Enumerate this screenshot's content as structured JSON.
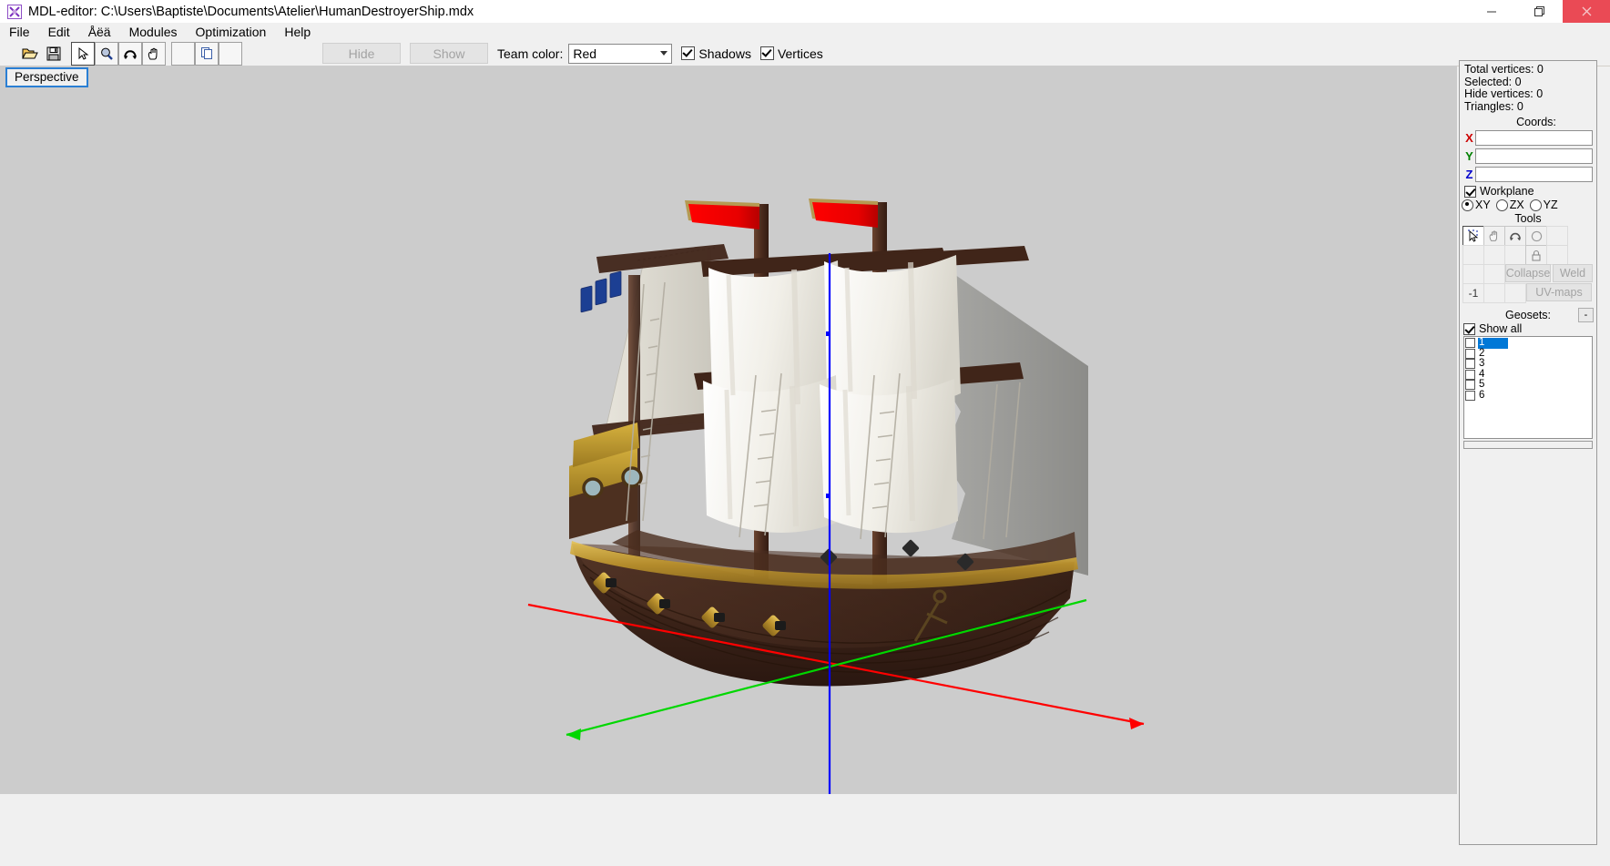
{
  "window": {
    "title": "MDL-editor: C:\\Users\\Baptiste\\Documents\\Atelier\\HumanDestroyerShip.mdx",
    "icon": "app-icon",
    "minimize": "—",
    "maximize": "❐",
    "close": "✕"
  },
  "menu": {
    "items": [
      {
        "label": "File"
      },
      {
        "label": "Edit"
      },
      {
        "label": "Åëä"
      },
      {
        "label": "Modules"
      },
      {
        "label": "Optimization"
      },
      {
        "label": "Help"
      }
    ]
  },
  "toolbar": {
    "open_icon": "open-folder-icon",
    "save_icon": "save-disk-icon",
    "select_icon": "arrow-cursor-icon",
    "zoom_icon": "magnifier-icon",
    "rotate_icon": "rotate-icon",
    "pan_icon": "hand-icon",
    "blank1_icon": "blank-icon",
    "copy_icon": "copy-icon",
    "blank2_icon": "blank-icon",
    "hide_label": "Hide",
    "show_label": "Show",
    "team_color_label": "Team color:",
    "team_color_value": "Red",
    "team_color_options": [
      "Red"
    ],
    "shadows_label": "Shadows",
    "shadows_checked": true,
    "vertices_label": "Vertices",
    "vertices_checked": true
  },
  "viewport": {
    "perspective_label": "Perspective",
    "background_color": "#cccccc",
    "axes": {
      "x_color": "#ff0000",
      "y_color": "#00d700",
      "z_color": "#0000ff"
    }
  },
  "panel": {
    "stats": {
      "total_vertices": "Total vertices: 0",
      "selected": "Selected: 0",
      "hide_vertices": "Hide vertices: 0",
      "triangles": "Triangles: 0"
    },
    "coords_title": "Coords:",
    "coords": [
      {
        "label": "X",
        "color": "#cc0000",
        "value": ""
      },
      {
        "label": "Y",
        "color": "#008000",
        "value": ""
      },
      {
        "label": "Z",
        "color": "#0000cc",
        "value": ""
      }
    ],
    "workplane_label": "Workplane",
    "workplane_checked": true,
    "planes": [
      {
        "label": "XY",
        "selected": true
      },
      {
        "label": "ZX",
        "selected": false
      },
      {
        "label": "YZ",
        "selected": false
      }
    ],
    "tools_title": "Tools",
    "tools": {
      "row1": [
        "select-vertices-icon",
        "hand-icon",
        "rotate-icon",
        "circle-icon",
        "blank-icon"
      ],
      "row2": [
        "blank-icon",
        "blank-icon",
        "blank-icon",
        "lock-icon",
        "blank-icon"
      ],
      "row3": [
        "blank-icon",
        "blank-icon"
      ],
      "row4_label": "-1"
    },
    "collapse_label": "Collapse",
    "weld_label": "Weld",
    "uvmaps_label": "UV-maps",
    "geosets_title": "Geosets:",
    "geosets_minimize": "-",
    "show_all_label": "Show all",
    "show_all_checked": true,
    "geoset_items": [
      {
        "label": "1",
        "checked": false,
        "selected": true
      },
      {
        "label": "2",
        "checked": false,
        "selected": false
      },
      {
        "label": "3",
        "checked": false,
        "selected": false
      },
      {
        "label": "4",
        "checked": false,
        "selected": false
      },
      {
        "label": "5",
        "checked": false,
        "selected": false
      },
      {
        "label": "6",
        "checked": false,
        "selected": false
      }
    ]
  }
}
